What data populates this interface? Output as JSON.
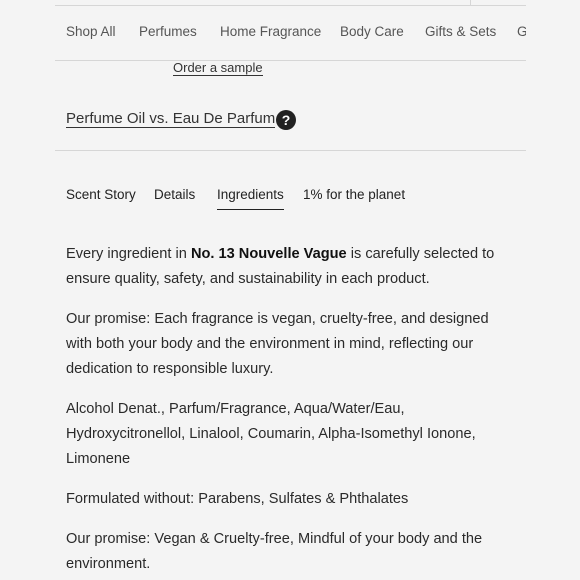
{
  "nav": {
    "items": [
      "Shop All",
      "Perfumes",
      "Home Fragrance",
      "Body Care",
      "Gifts & Sets",
      "G"
    ]
  },
  "order_sample": "Order a sample",
  "oil_vs_edp": "Perfume Oil vs. Eau De Parfum",
  "help_icon_glyph": "?",
  "tabs": [
    "Scent Story",
    "Details",
    "Ingredients",
    "1% for the planet"
  ],
  "active_tab": "Ingredients",
  "ingredients": {
    "intro_before": "Every ingredient in ",
    "product_name": "No. 13 Nouvelle Vague",
    "intro_after": " is carefully selected to ensure quality, safety, and sustainability in each product.",
    "promise": "Our promise: Each fragrance is vegan, cruelty-free, and designed with both your body and the environment in mind, reflecting our dedication to responsible luxury.",
    "list": "Alcohol Denat., Parfum/Fragrance, Aqua/Water/Eau, Hydroxycitronellol, Linalool, Coumarin, Alpha-Isomethyl Ionone, Limonene",
    "formulated_without": "Formulated without: Parabens, Sulfates & Phthalates",
    "promise_short": "Our promise: Vegan & Cruelty-free, Mindful of your body and the environment."
  }
}
